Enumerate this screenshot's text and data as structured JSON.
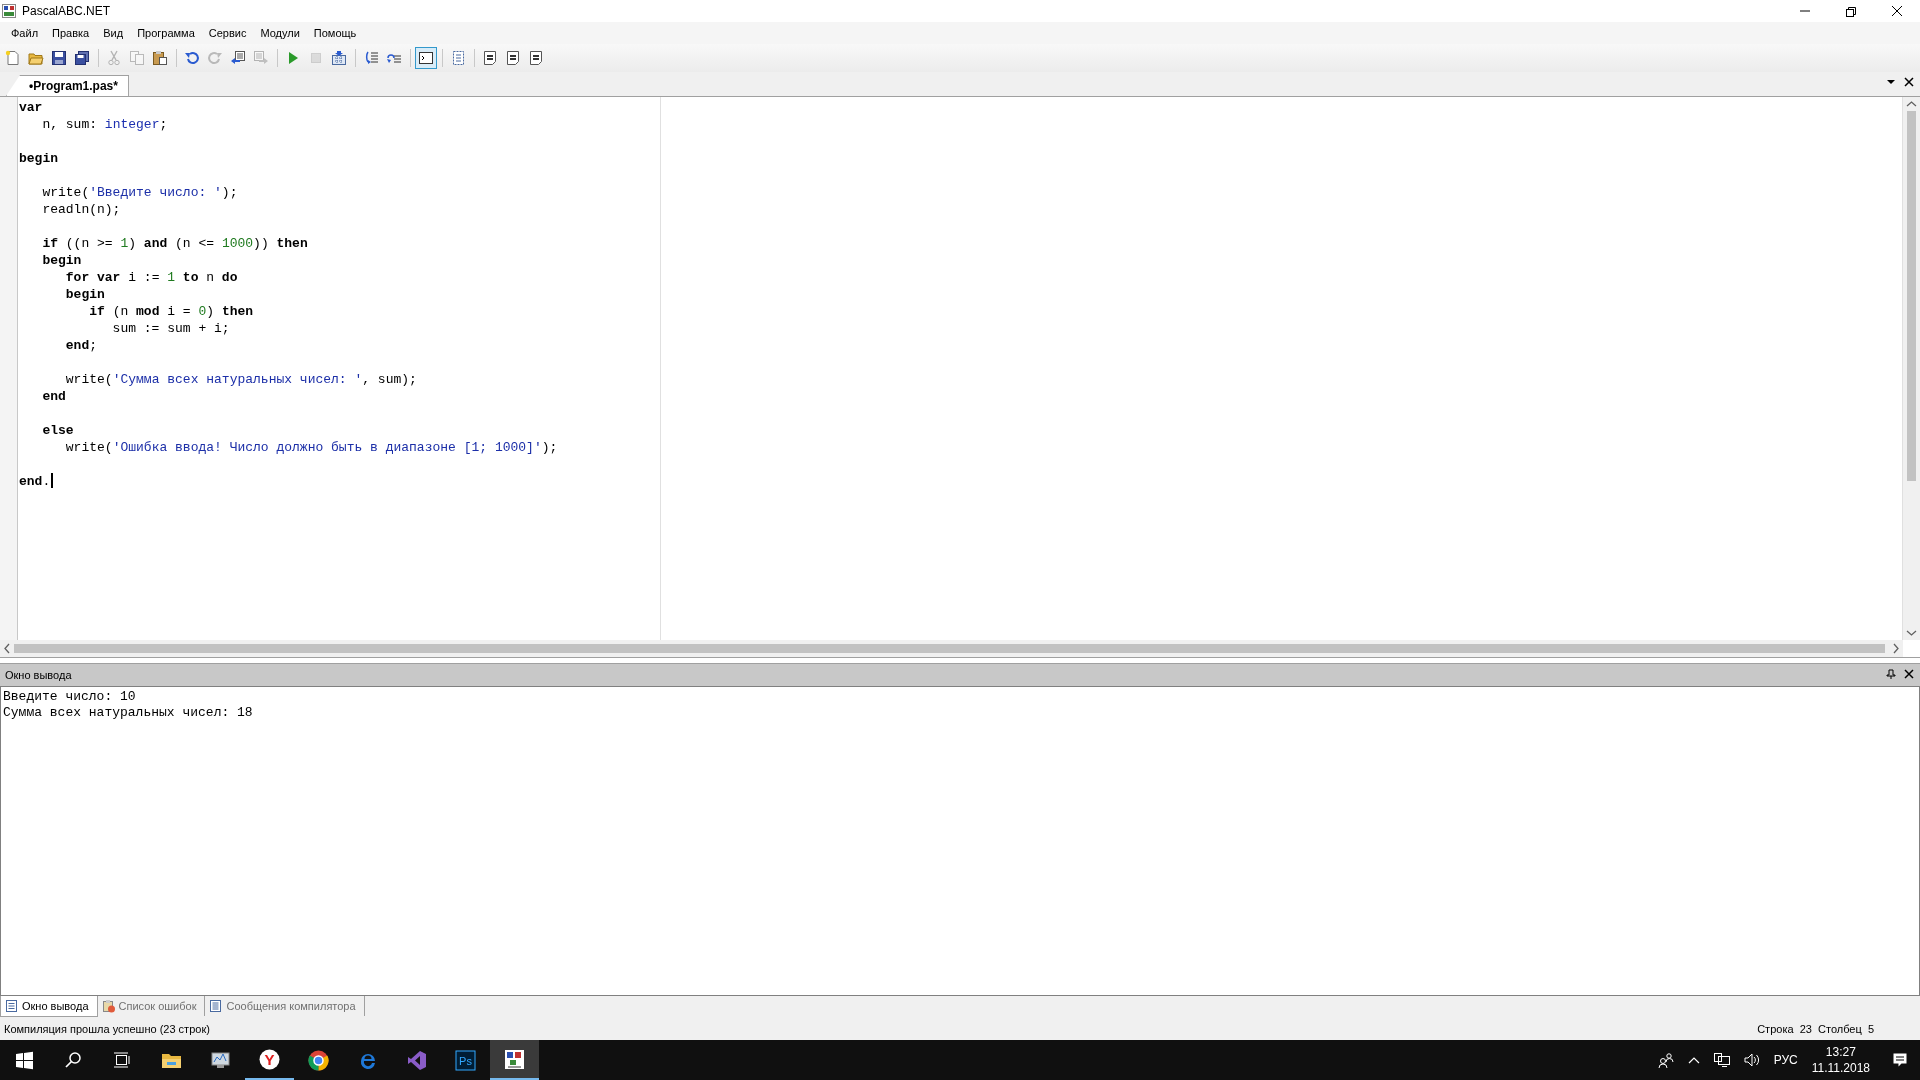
{
  "window": {
    "title": "PascalABC.NET"
  },
  "menu": [
    "Файл",
    "Правка",
    "Вид",
    "Программа",
    "Сервис",
    "Модули",
    "Помощь"
  ],
  "toolbar": [
    {
      "kind": "new",
      "disabled": false,
      "pressed": false
    },
    {
      "kind": "open",
      "disabled": false,
      "pressed": false
    },
    {
      "kind": "save",
      "disabled": false,
      "pressed": false
    },
    {
      "kind": "saveall",
      "disabled": false,
      "pressed": false
    },
    {
      "kind": "separator"
    },
    {
      "kind": "cut",
      "disabled": true,
      "pressed": false
    },
    {
      "kind": "copy",
      "disabled": true,
      "pressed": false
    },
    {
      "kind": "paste",
      "disabled": false,
      "pressed": false
    },
    {
      "kind": "separator"
    },
    {
      "kind": "undo",
      "disabled": false,
      "pressed": false
    },
    {
      "kind": "redo",
      "disabled": true,
      "pressed": false
    },
    {
      "kind": "back",
      "disabled": false,
      "pressed": false
    },
    {
      "kind": "forward",
      "disabled": true,
      "pressed": false
    },
    {
      "kind": "separator"
    },
    {
      "kind": "run",
      "disabled": false,
      "pressed": false
    },
    {
      "kind": "stop",
      "disabled": true,
      "pressed": false
    },
    {
      "kind": "build",
      "disabled": false,
      "pressed": false
    },
    {
      "kind": "separator"
    },
    {
      "kind": "stepin",
      "disabled": false,
      "pressed": false
    },
    {
      "kind": "stepover",
      "disabled": false,
      "pressed": false
    },
    {
      "kind": "separator"
    },
    {
      "kind": "console",
      "disabled": false,
      "pressed": true
    },
    {
      "kind": "separator"
    },
    {
      "kind": "outline",
      "disabled": false,
      "pressed": false
    },
    {
      "kind": "separator"
    },
    {
      "kind": "doc",
      "disabled": false,
      "pressed": false
    },
    {
      "kind": "doc",
      "disabled": false,
      "pressed": false
    },
    {
      "kind": "doc",
      "disabled": false,
      "pressed": false
    }
  ],
  "document_tabs": [
    {
      "label": "•Program1.pas*",
      "selected": true
    }
  ],
  "editor": {
    "lines": [
      {
        "kind": "code",
        "caret": false,
        "tokens": [
          {
            "kind": "kw",
            "text": "var"
          }
        ]
      },
      {
        "kind": "code",
        "caret": false,
        "tokens": [
          {
            "kind": "plain",
            "text": "   n, sum: "
          },
          {
            "kind": "type",
            "text": "integer"
          },
          {
            "kind": "plain",
            "text": ";"
          }
        ]
      },
      {
        "kind": "blank"
      },
      {
        "kind": "code",
        "caret": false,
        "tokens": [
          {
            "kind": "kw",
            "text": "begin"
          }
        ]
      },
      {
        "kind": "blank"
      },
      {
        "kind": "code",
        "caret": false,
        "tokens": [
          {
            "kind": "plain",
            "text": "   write("
          },
          {
            "kind": "str",
            "text": "'Введите число: '"
          },
          {
            "kind": "plain",
            "text": ");"
          }
        ]
      },
      {
        "kind": "code",
        "caret": false,
        "tokens": [
          {
            "kind": "plain",
            "text": "   readln(n);"
          }
        ]
      },
      {
        "kind": "blank"
      },
      {
        "kind": "code",
        "caret": false,
        "tokens": [
          {
            "kind": "kw",
            "text": "   if"
          },
          {
            "kind": "plain",
            "text": " ((n >= "
          },
          {
            "kind": "num",
            "text": "1"
          },
          {
            "kind": "plain",
            "text": ") "
          },
          {
            "kind": "kw",
            "text": "and"
          },
          {
            "kind": "plain",
            "text": " (n <= "
          },
          {
            "kind": "num",
            "text": "1000"
          },
          {
            "kind": "plain",
            "text": ")) "
          },
          {
            "kind": "kw",
            "text": "then"
          }
        ]
      },
      {
        "kind": "code",
        "caret": false,
        "tokens": [
          {
            "kind": "kw",
            "text": "   begin"
          }
        ]
      },
      {
        "kind": "code",
        "caret": false,
        "tokens": [
          {
            "kind": "kw",
            "text": "      for var"
          },
          {
            "kind": "plain",
            "text": " i := "
          },
          {
            "kind": "num",
            "text": "1"
          },
          {
            "kind": "kw",
            "text": " to"
          },
          {
            "kind": "plain",
            "text": " n "
          },
          {
            "kind": "kw",
            "text": "do"
          }
        ]
      },
      {
        "kind": "code",
        "caret": false,
        "tokens": [
          {
            "kind": "kw",
            "text": "      begin"
          }
        ]
      },
      {
        "kind": "code",
        "caret": false,
        "tokens": [
          {
            "kind": "kw",
            "text": "         if"
          },
          {
            "kind": "plain",
            "text": " (n "
          },
          {
            "kind": "kw",
            "text": "mod"
          },
          {
            "kind": "plain",
            "text": " i = "
          },
          {
            "kind": "num",
            "text": "0"
          },
          {
            "kind": "plain",
            "text": ") "
          },
          {
            "kind": "kw",
            "text": "then"
          }
        ]
      },
      {
        "kind": "code",
        "caret": false,
        "tokens": [
          {
            "kind": "plain",
            "text": "            sum := sum + i;"
          }
        ]
      },
      {
        "kind": "code",
        "caret": false,
        "tokens": [
          {
            "kind": "kw",
            "text": "      end"
          },
          {
            "kind": "plain",
            "text": ";"
          }
        ]
      },
      {
        "kind": "blank"
      },
      {
        "kind": "code",
        "caret": false,
        "tokens": [
          {
            "kind": "plain",
            "text": "      write("
          },
          {
            "kind": "str",
            "text": "'Сумма всех натуральных чисел: '"
          },
          {
            "kind": "plain",
            "text": ", sum);"
          }
        ]
      },
      {
        "kind": "code",
        "caret": false,
        "tokens": [
          {
            "kind": "kw",
            "text": "   end"
          }
        ]
      },
      {
        "kind": "blank"
      },
      {
        "kind": "code",
        "caret": false,
        "tokens": [
          {
            "kind": "kw",
            "text": "   else"
          }
        ]
      },
      {
        "kind": "code",
        "caret": false,
        "tokens": [
          {
            "kind": "plain",
            "text": "      write("
          },
          {
            "kind": "str",
            "text": "'Ошибка ввода! Число должно быть в диапазоне [1; 1000]'"
          },
          {
            "kind": "plain",
            "text": ");"
          }
        ]
      },
      {
        "kind": "blank"
      },
      {
        "kind": "code",
        "caret": true,
        "tokens": [
          {
            "kind": "kw",
            "text": "end"
          },
          {
            "kind": "plain",
            "text": "."
          }
        ]
      }
    ]
  },
  "output_panel": {
    "title": "Окно вывода",
    "lines": [
      "Введите число: 10",
      "Сумма всех натуральных чисел: 18"
    ]
  },
  "bottom_tabs": [
    {
      "kind": "output",
      "label": "Окно вывода",
      "selected": true
    },
    {
      "kind": "errors",
      "label": "Список ошибок",
      "selected": false
    },
    {
      "kind": "messages",
      "label": "Сообщения компилятора",
      "selected": false
    }
  ],
  "status_bar": {
    "message": "Компиляция прошла успешно (23 строк)",
    "position": "Строка  23  Столбец  5"
  },
  "taskbar": {
    "items": [
      {
        "kind": "start",
        "running": false,
        "active": false
      },
      {
        "kind": "search",
        "running": false,
        "active": false
      },
      {
        "kind": "taskview",
        "running": false,
        "active": false
      },
      {
        "kind": "folder",
        "running": false,
        "active": false
      },
      {
        "kind": "monitor",
        "running": false,
        "active": false
      },
      {
        "kind": "ycircle",
        "label": "Y",
        "running": true,
        "active": false
      },
      {
        "kind": "wheel",
        "running": false,
        "active": false
      },
      {
        "kind": "edge",
        "running": false,
        "active": false
      },
      {
        "kind": "vs",
        "running": false,
        "active": false
      },
      {
        "kind": "ps",
        "label": "Ps",
        "running": false,
        "active": false
      },
      {
        "kind": "abc",
        "running": true,
        "active": true
      }
    ],
    "language": "РУС",
    "time": "13:27",
    "date": "11.11.2018"
  }
}
